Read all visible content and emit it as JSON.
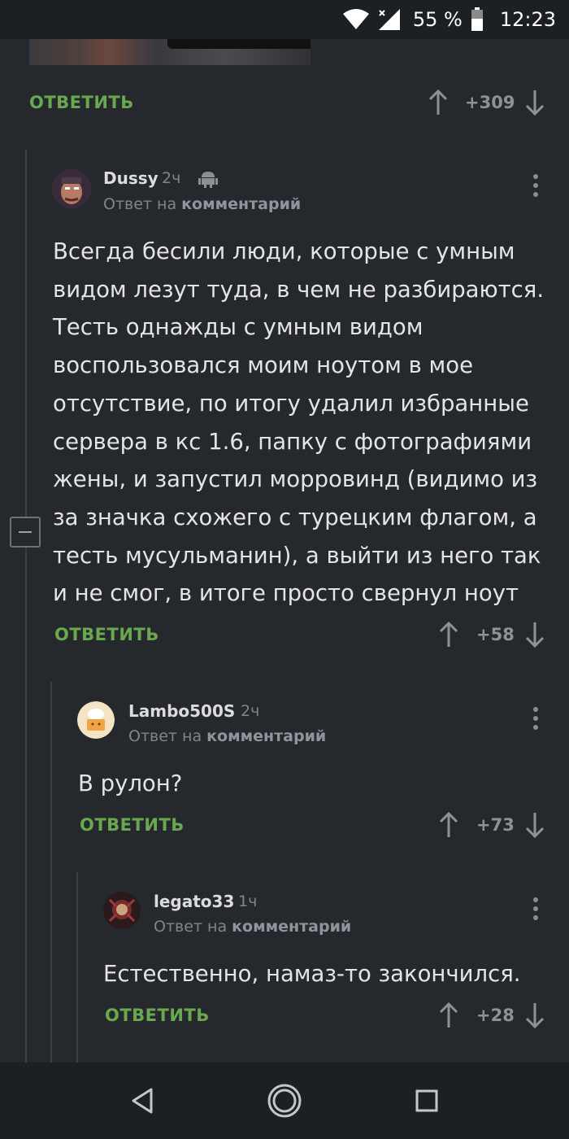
{
  "status_bar": {
    "battery": "55 %",
    "time": "12:23"
  },
  "prev_comment": {
    "reply_label": "ОТВЕТИТЬ",
    "score": "+309"
  },
  "comments": [
    {
      "username": "Dussy",
      "time": "2ч",
      "reply_prefix": "Ответ на",
      "reply_target": "комментарий",
      "text": [
        "Всегда бесили люди, которые с умным",
        "видом лезут туда, в чем не разбираются.",
        "Тесть однажды с умным видом",
        "воспользовался моим ноутом в мое",
        "отсутствие, по итогу удалил избранные",
        "сервера в кс 1.6, папку с фотографиями",
        "жены, и запустил морровинд (видимо из",
        "за значка схожего с турецким флагом, а",
        "тесть мусульманин), а выйти из него так",
        "и не смог, в итоге просто свернул ноут"
      ],
      "reply_label": "ОТВЕТИТЬ",
      "score": "+58"
    },
    {
      "username": "Lambo500S",
      "time": "2ч",
      "reply_prefix": "Ответ на",
      "reply_target": "комментарий",
      "text": [
        "В рулон?"
      ],
      "reply_label": "ОТВЕТИТЬ",
      "score": "+73"
    },
    {
      "username": "legato33",
      "time": "1ч",
      "reply_prefix": "Ответ на",
      "reply_target": "комментарий",
      "text": [
        "Естественно, намаз-то закончился."
      ],
      "reply_label": "ОТВЕТИТЬ",
      "score": "+28"
    }
  ],
  "colors": {
    "background": "#25292d",
    "reply_green": "#6aa84f",
    "bars": "#1d2023"
  }
}
